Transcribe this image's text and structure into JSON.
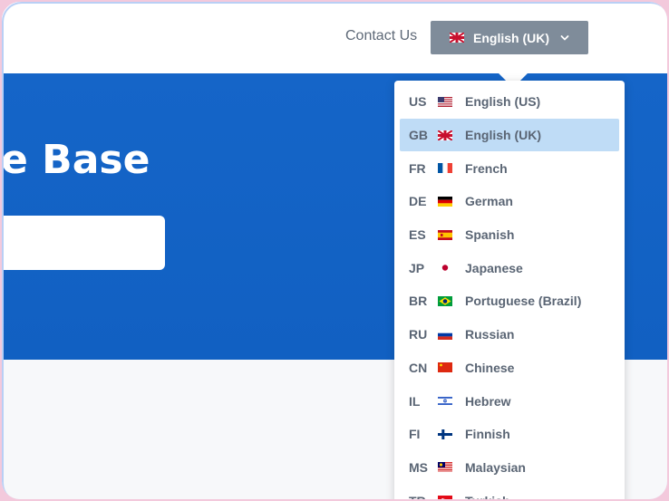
{
  "header": {
    "contact_label": "Contact Us",
    "language_button_label": "English (UK)"
  },
  "hero": {
    "title": "e Base"
  },
  "dropdown": {
    "selected_index": 1,
    "items": [
      {
        "code": "US",
        "label": "English (US)",
        "flag": "us-flag-icon"
      },
      {
        "code": "GB",
        "label": "English (UK)",
        "flag": "gb-flag-icon"
      },
      {
        "code": "FR",
        "label": "French",
        "flag": "fr-flag-icon"
      },
      {
        "code": "DE",
        "label": "German",
        "flag": "de-flag-icon"
      },
      {
        "code": "ES",
        "label": "Spanish",
        "flag": "es-flag-icon"
      },
      {
        "code": "JP",
        "label": "Japanese",
        "flag": "jp-flag-icon"
      },
      {
        "code": "BR",
        "label": "Portuguese (Brazil)",
        "flag": "br-flag-icon"
      },
      {
        "code": "RU",
        "label": "Russian",
        "flag": "ru-flag-icon"
      },
      {
        "code": "CN",
        "label": "Chinese",
        "flag": "cn-flag-icon"
      },
      {
        "code": "IL",
        "label": "Hebrew",
        "flag": "il-flag-icon"
      },
      {
        "code": "FI",
        "label": "Finnish",
        "flag": "fi-flag-icon"
      },
      {
        "code": "MS",
        "label": "Malaysian",
        "flag": "my-flag-icon"
      },
      {
        "code": "TR",
        "label": "Turkish",
        "flag": "tr-flag-icon"
      }
    ]
  },
  "colors": {
    "hero_blue": "#1565c8",
    "button_gray": "#7f8c9a",
    "selected_bg": "#bfdcf6",
    "text_gray": "#5f6a78"
  }
}
